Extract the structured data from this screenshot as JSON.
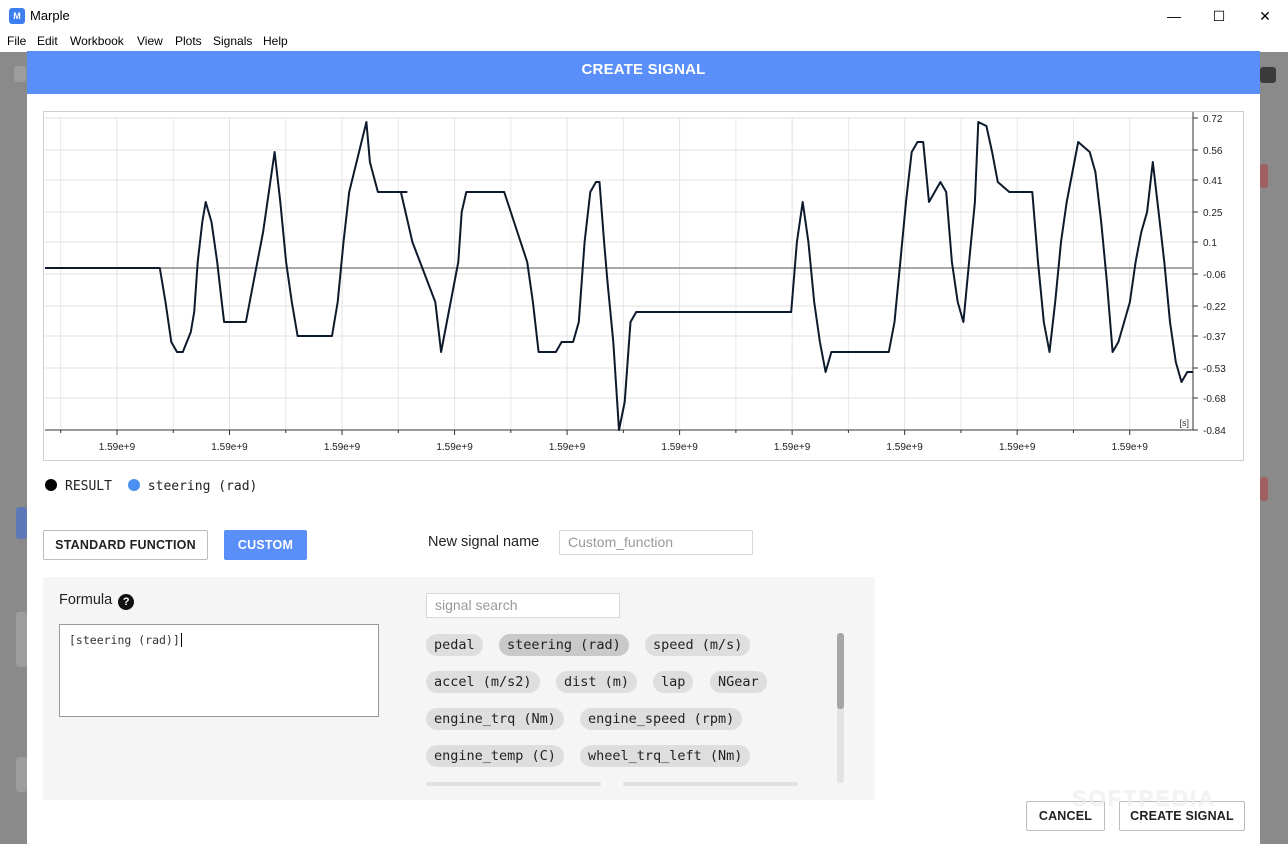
{
  "window": {
    "title": "Marple",
    "icon": "marple-logo-icon",
    "minimize": "—",
    "maximize": "☐",
    "close": "✕"
  },
  "menu": [
    "File",
    "Edit",
    "Workbook",
    "View",
    "Plots",
    "Signals",
    "Help"
  ],
  "dialog": {
    "title": "CREATE SIGNAL",
    "legend": [
      {
        "label": "RESULT",
        "color": "#000000"
      },
      {
        "label": "steering (rad)",
        "color": "#4a90f0"
      }
    ],
    "standard_function_label": "STANDARD FUNCTION",
    "custom_label": "CUSTOM",
    "new_signal_name_label": "New signal name",
    "new_signal_name_placeholder": "Custom_function",
    "formula_label": "Formula",
    "formula_value": "[steering (rad)]",
    "signal_search_placeholder": "signal search",
    "signals": [
      "pedal",
      "steering (rad)",
      "speed (m/s)",
      "accel (m/s2)",
      "dist (m)",
      "lap",
      "NGear",
      "engine_trq (Nm)",
      "engine_speed (rpm)",
      "engine_temp (C)",
      "wheel_trq_left (Nm)"
    ],
    "selected_signal": "steering (rad)",
    "cancel_label": "CANCEL",
    "create_label": "CREATE SIGNAL"
  },
  "watermark": "SOFTPEDIA",
  "chart_data": {
    "type": "line",
    "x_tick_labels": [
      "1.59e+9",
      "1.59e+9",
      "1.59e+9",
      "1.59e+9",
      "1.59e+9",
      "1.59e+9",
      "1.59e+9",
      "1.59e+9",
      "1.59e+9",
      "1.59e+9"
    ],
    "x_unit": "[s]",
    "y_ticks": [
      0.72,
      0.56,
      0.41,
      0.25,
      0.1,
      -0.06,
      -0.22,
      -0.37,
      -0.53,
      -0.68,
      -0.84
    ],
    "y_tick_labels": [
      "0.72",
      "0.56",
      "0.41",
      "0.25",
      "0.1",
      "-0.06",
      "-0.22",
      "-0.37",
      "-0.53",
      "-0.68",
      "-0.84"
    ],
    "ylim": [
      -0.84,
      0.72
    ],
    "x_range": [
      0,
      1
    ],
    "grid": true,
    "reference_level": -0.03,
    "series": [
      {
        "name": "RESULT",
        "color": "#0d1a2b",
        "x": [
          0.0,
          0.1,
          0.105,
          0.11,
          0.115,
          0.12,
          0.127,
          0.13,
          0.133,
          0.137,
          0.14,
          0.145,
          0.15,
          0.153,
          0.156,
          0.16,
          0.162,
          0.165,
          0.17,
          0.175,
          0.18,
          0.19,
          0.2,
          0.205,
          0.21,
          0.215,
          0.22,
          0.225,
          0.23,
          0.232,
          0.235,
          0.24,
          0.25,
          0.255,
          0.26,
          0.265,
          0.28,
          0.283,
          0.29,
          0.3,
          0.305,
          0.31,
          0.315,
          0.31,
          0.32,
          0.34,
          0.345,
          0.36,
          0.363,
          0.367,
          0.37,
          0.375,
          0.38,
          0.39,
          0.4,
          0.42,
          0.425,
          0.43,
          0.44,
          0.445,
          0.45,
          0.46,
          0.465,
          0.47,
          0.475,
          0.48,
          0.483,
          0.487,
          0.49,
          0.495,
          0.5,
          0.505,
          0.51,
          0.515,
          0.53,
          0.54,
          0.6,
          0.64,
          0.645,
          0.65,
          0.655,
          0.66,
          0.665,
          0.67,
          0.675,
          0.68,
          0.685,
          0.7,
          0.73,
          0.735,
          0.74,
          0.745,
          0.75,
          0.755,
          0.76,
          0.765,
          0.77,
          0.78,
          0.785,
          0.79,
          0.795,
          0.8,
          0.805,
          0.81,
          0.813,
          0.82,
          0.825,
          0.83,
          0.84,
          0.85,
          0.86,
          0.865,
          0.87,
          0.875,
          0.88,
          0.885,
          0.89,
          0.9,
          0.91,
          0.915,
          0.92,
          0.925,
          0.93,
          0.935,
          0.945,
          0.95,
          0.955,
          0.96,
          0.965,
          0.97,
          0.975,
          0.98,
          0.985,
          0.99,
          0.995,
          1.0
        ],
        "y": [
          -0.03,
          -0.03,
          -0.2,
          -0.4,
          -0.45,
          -0.45,
          -0.35,
          -0.25,
          0.0,
          0.2,
          0.3,
          0.2,
          0.0,
          -0.15,
          -0.3,
          -0.3,
          -0.3,
          -0.3,
          -0.3,
          -0.3,
          -0.15,
          0.15,
          0.55,
          0.3,
          0.0,
          -0.2,
          -0.37,
          -0.37,
          -0.37,
          -0.37,
          -0.37,
          -0.37,
          -0.37,
          -0.2,
          0.1,
          0.35,
          0.7,
          0.5,
          0.35,
          0.35,
          0.35,
          0.35,
          0.35,
          0.35,
          0.1,
          -0.2,
          -0.45,
          0.0,
          0.25,
          0.35,
          0.35,
          0.35,
          0.35,
          0.35,
          0.35,
          0.0,
          -0.2,
          -0.45,
          -0.45,
          -0.45,
          -0.4,
          -0.4,
          -0.3,
          0.1,
          0.35,
          0.4,
          0.4,
          0.1,
          -0.1,
          -0.4,
          -0.84,
          -0.7,
          -0.3,
          -0.25,
          -0.25,
          -0.25,
          -0.25,
          -0.25,
          -0.25,
          -0.25,
          0.1,
          0.3,
          0.1,
          -0.2,
          -0.4,
          -0.55,
          -0.45,
          -0.45,
          -0.45,
          -0.45,
          -0.3,
          0.0,
          0.3,
          0.55,
          0.6,
          0.6,
          0.3,
          0.4,
          0.35,
          0.0,
          -0.2,
          -0.3,
          0.0,
          0.3,
          0.7,
          0.68,
          0.55,
          0.4,
          0.35,
          0.35,
          0.35,
          0.0,
          -0.3,
          -0.45,
          -0.2,
          0.1,
          0.3,
          0.6,
          0.55,
          0.45,
          0.2,
          -0.1,
          -0.45,
          -0.4,
          -0.2,
          0.0,
          0.15,
          0.25,
          0.5,
          0.25,
          0.0,
          -0.3,
          -0.5,
          -0.6,
          -0.55,
          -0.55
        ]
      }
    ]
  }
}
